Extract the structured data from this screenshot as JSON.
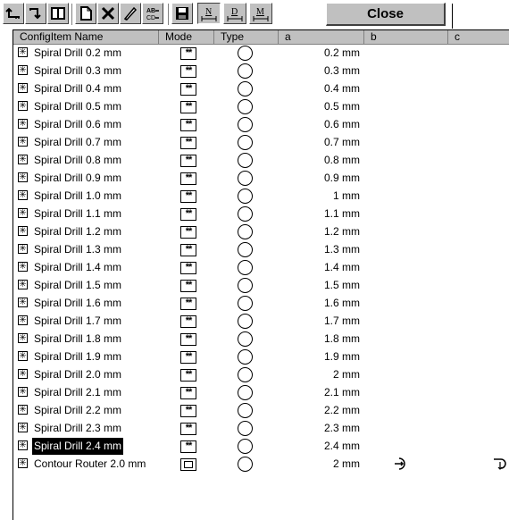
{
  "toolbar": {
    "buttons": [
      {
        "icon": "arrow-up-left-icon"
      },
      {
        "icon": "arrow-down-right-icon"
      },
      {
        "icon": "split-view-icon"
      },
      {
        "icon": "new-document-icon"
      },
      {
        "icon": "cut-icon"
      },
      {
        "icon": "edit-icon"
      },
      {
        "icon": "rename-ab-icon"
      },
      {
        "icon": "save-icon"
      },
      {
        "icon": "mode-n-icon",
        "label": "N"
      },
      {
        "icon": "mode-d-icon",
        "label": "D"
      },
      {
        "icon": "mode-m-icon",
        "label": "M"
      }
    ],
    "close_label": "Close"
  },
  "columns": [
    {
      "label": "ConfigItem Name"
    },
    {
      "label": "Mode"
    },
    {
      "label": "Type"
    },
    {
      "label": "a"
    },
    {
      "label": "b"
    },
    {
      "label": "c"
    }
  ],
  "rows": [
    {
      "name": "Spiral Drill 0.2 mm",
      "mode": "**",
      "a": "0.2 mm"
    },
    {
      "name": "Spiral Drill 0.3 mm",
      "mode": "**",
      "a": "0.3 mm"
    },
    {
      "name": "Spiral Drill 0.4 mm",
      "mode": "**",
      "a": "0.4 mm"
    },
    {
      "name": "Spiral Drill 0.5 mm",
      "mode": "**",
      "a": "0.5 mm"
    },
    {
      "name": "Spiral Drill 0.6 mm",
      "mode": "**",
      "a": "0.6 mm"
    },
    {
      "name": "Spiral Drill 0.7 mm",
      "mode": "**",
      "a": "0.7 mm"
    },
    {
      "name": "Spiral Drill 0.8 mm",
      "mode": "**",
      "a": "0.8 mm"
    },
    {
      "name": "Spiral Drill 0.9 mm",
      "mode": "**",
      "a": "0.9 mm"
    },
    {
      "name": "Spiral Drill 1.0 mm",
      "mode": "**",
      "a": "1 mm"
    },
    {
      "name": "Spiral Drill 1.1 mm",
      "mode": "**",
      "a": "1.1 mm"
    },
    {
      "name": "Spiral Drill 1.2 mm",
      "mode": "**",
      "a": "1.2 mm"
    },
    {
      "name": "Spiral Drill 1.3 mm",
      "mode": "**",
      "a": "1.3 mm"
    },
    {
      "name": "Spiral Drill 1.4 mm",
      "mode": "**",
      "a": "1.4 mm"
    },
    {
      "name": "Spiral Drill 1.5 mm",
      "mode": "**",
      "a": "1.5 mm"
    },
    {
      "name": "Spiral Drill 1.6 mm",
      "mode": "**",
      "a": "1.6 mm"
    },
    {
      "name": "Spiral Drill 1.7 mm",
      "mode": "**",
      "a": "1.7 mm"
    },
    {
      "name": "Spiral Drill 1.8 mm",
      "mode": "**",
      "a": "1.8 mm"
    },
    {
      "name": "Spiral Drill 1.9 mm",
      "mode": "**",
      "a": "1.9 mm"
    },
    {
      "name": "Spiral Drill 2.0 mm",
      "mode": "**",
      "a": "2 mm"
    },
    {
      "name": "Spiral Drill 2.1 mm",
      "mode": "**",
      "a": "2.1 mm"
    },
    {
      "name": "Spiral Drill 2.2 mm",
      "mode": "**",
      "a": "2.2 mm"
    },
    {
      "name": "Spiral Drill 2.3 mm",
      "mode": "**",
      "a": "2.3 mm"
    },
    {
      "name": "Spiral Drill 2.4 mm",
      "mode": "**",
      "a": "2.4 mm",
      "selected": true
    },
    {
      "name": "Contour Router 2.0 mm",
      "mode": "box",
      "a": "2 mm",
      "b_icon": "tool-entry-icon",
      "c_icon": "tool-exit-icon"
    }
  ]
}
